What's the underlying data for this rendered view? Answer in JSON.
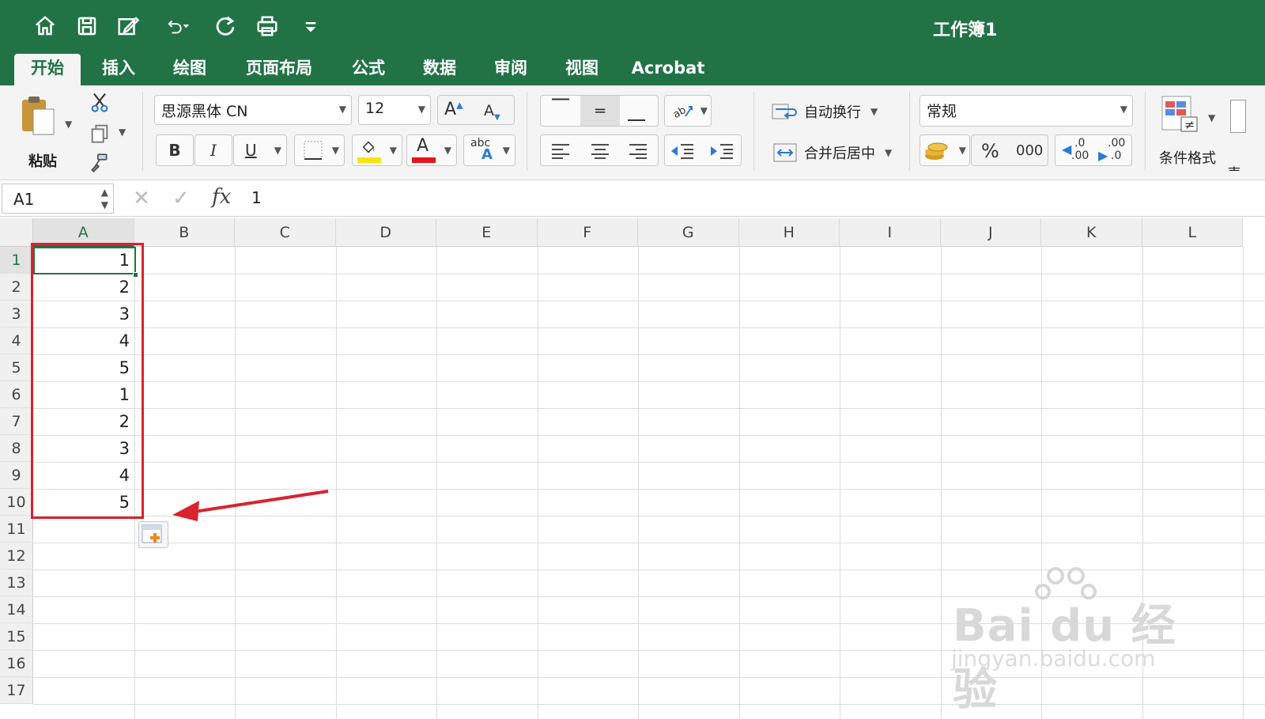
{
  "app": {
    "accent": "#217346",
    "annotation_color": "#d9232e"
  },
  "title_bar": {
    "doc_title": "工作簿1",
    "quick_access": [
      "home-icon",
      "save-icon",
      "edit-icon",
      "undo-icon",
      "redo-icon",
      "print-icon",
      "customize-icon"
    ]
  },
  "tabs": [
    "开始",
    "插入",
    "绘图",
    "页面布局",
    "公式",
    "数据",
    "审阅",
    "视图",
    "Acrobat"
  ],
  "active_tab": "开始",
  "ribbon": {
    "paste_label": "粘贴",
    "font_name": "思源黑体 CN",
    "font_size": "12",
    "grow_font": "A",
    "shrink_font": "A",
    "bold": "B",
    "italic": "I",
    "underline": "U",
    "font_color_glyph": "A",
    "highlight_color": "#f5e60a",
    "font_color": "#e8141a",
    "phonetic": "abc",
    "phonetic_a": "A",
    "wrap_text": "自动换行",
    "merge_center": "合并后居中",
    "number_format": "常规",
    "percent": "%",
    "comma": "000",
    "increase_decimal_top": ".0",
    "increase_decimal_bottom": ".00",
    "decrease_decimal_top": ".00",
    "decrease_decimal_bottom": ".0",
    "conditional_format": "条件格式",
    "table_format_partial": "表"
  },
  "formula_bar": {
    "name_box": "A1",
    "fx": "fx",
    "value": "1"
  },
  "sheet": {
    "columns": [
      "A",
      "B",
      "C",
      "D",
      "E",
      "F",
      "G",
      "H",
      "I",
      "J",
      "K",
      "L"
    ],
    "rows": [
      "1",
      "2",
      "3",
      "4",
      "5",
      "6",
      "7",
      "8",
      "9",
      "10",
      "11",
      "12",
      "13",
      "14",
      "15",
      "16",
      "17"
    ],
    "selected_cell": "A1",
    "column_a_values": [
      "1",
      "2",
      "3",
      "4",
      "5",
      "1",
      "2",
      "3",
      "4",
      "5"
    ]
  },
  "watermark": {
    "logo": "Bai du 经验",
    "url": "jingyan.baidu.com"
  }
}
